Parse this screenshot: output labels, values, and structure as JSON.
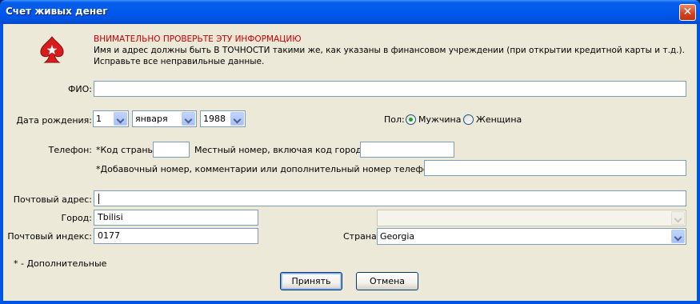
{
  "window": {
    "title": "Счет живых денег",
    "close_glyph": "✕"
  },
  "notice": {
    "heading": "ВНИМАТЕЛЬНО ПРОВЕРЬТЕ ЭТУ ИНФОРМАЦИЮ",
    "line1": "Имя и адрес должны быть В ТОЧНОСТИ такими же, как указаны в финансовом учреждении (при открытии кредитной карты и т.д.).",
    "line2": "Исправьте все неправильные данные.",
    "icon": "spade-logo-icon"
  },
  "form": {
    "fio_label": "ФИО:",
    "fio_value": "",
    "dob_label": "Дата рождения:",
    "dob_day": "1",
    "dob_month": "января",
    "dob_year": "1988",
    "gender_label": "Пол:",
    "gender_male": "Мужчина",
    "gender_female": "Женщина",
    "gender_selected": "Мужчина",
    "phone_label": "Телефон:",
    "country_code_label": "*Код страны:",
    "country_code_value": "",
    "local_number_label": "Местный номер, включая код города:",
    "local_number_value": "",
    "extension_label": "*Добавочный номер, комментарии или дополнительный номер телефона:",
    "extension_value": "",
    "address_label": "Почтовый адрес:",
    "address_value": "",
    "city_label": "Город:",
    "city_value": "Tbilisi",
    "region_value": "",
    "postal_label": "Почтовый индекс:",
    "postal_value": "0177",
    "country_label": "Страна:",
    "country_value": "Georgia"
  },
  "footer": {
    "optional_note": "* - Дополнительные",
    "accept_label": "Принять",
    "cancel_label": "Отмена"
  },
  "colors": {
    "titlebar": "#0058ee",
    "client": "#ece9d8",
    "warning": "#cc0000",
    "input_border": "#7f9db9"
  }
}
